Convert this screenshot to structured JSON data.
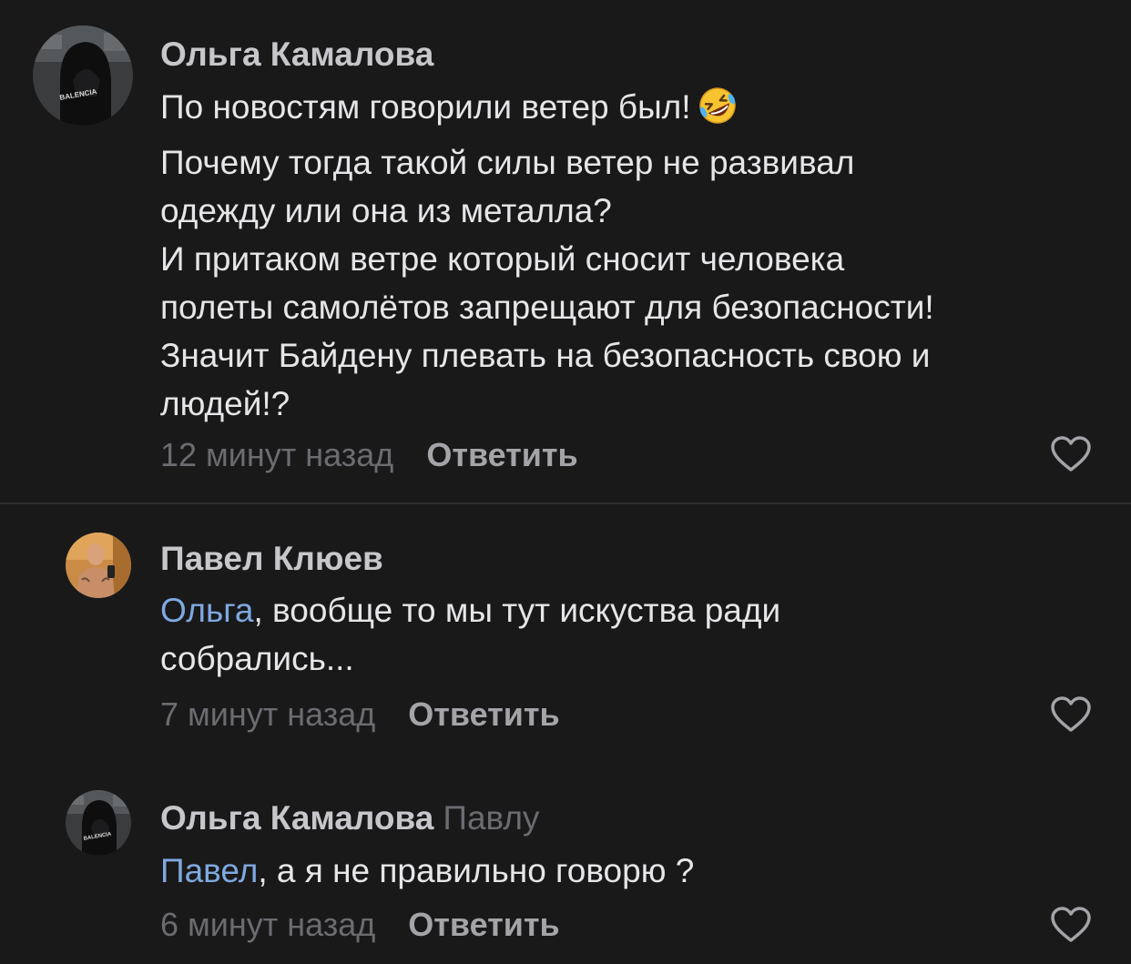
{
  "comments": [
    {
      "author": "Ольга Камалова",
      "avatar_icon": "hooded-person-avatar",
      "text_lines": [
        "По новостям говорили ветер был!",
        "Почему тогда такой силы ветер не развивал",
        "одежду или она из металла?",
        "И притаком ветре который сносит человека",
        "полеты самолётов запрещают для безопасности!",
        "Значит Байдену плевать на безопасность свою и",
        "людей!?"
      ],
      "emoji": "rolling-on-floor-laughing-emoji",
      "time": "12 минут назад",
      "reply_label": "Ответить",
      "like_icon": "heart-outline-icon"
    },
    {
      "author": "Павел Клюев",
      "avatar_icon": "man-selfie-avatar",
      "mention": "Ольга",
      "text_lines": [
        ", вообще то мы тут искуства ради",
        "собрались..."
      ],
      "time": "7 минут назад",
      "reply_label": "Ответить",
      "like_icon": "heart-outline-icon"
    },
    {
      "author": "Ольга Камалова",
      "reply_to": "Павлу",
      "avatar_icon": "hooded-person-avatar",
      "mention": "Павел",
      "text_lines": [
        ", а я не правильно говорю ?"
      ],
      "time": "6 минут назад",
      "reply_label": "Ответить",
      "like_icon": "heart-outline-icon"
    }
  ],
  "colors": {
    "background": "#19191a",
    "text": "#e6e6e8",
    "author": "#c7c7cb",
    "muted": "#6b6b70",
    "mention": "#7fa9e0",
    "divider": "#2c2c2e"
  }
}
